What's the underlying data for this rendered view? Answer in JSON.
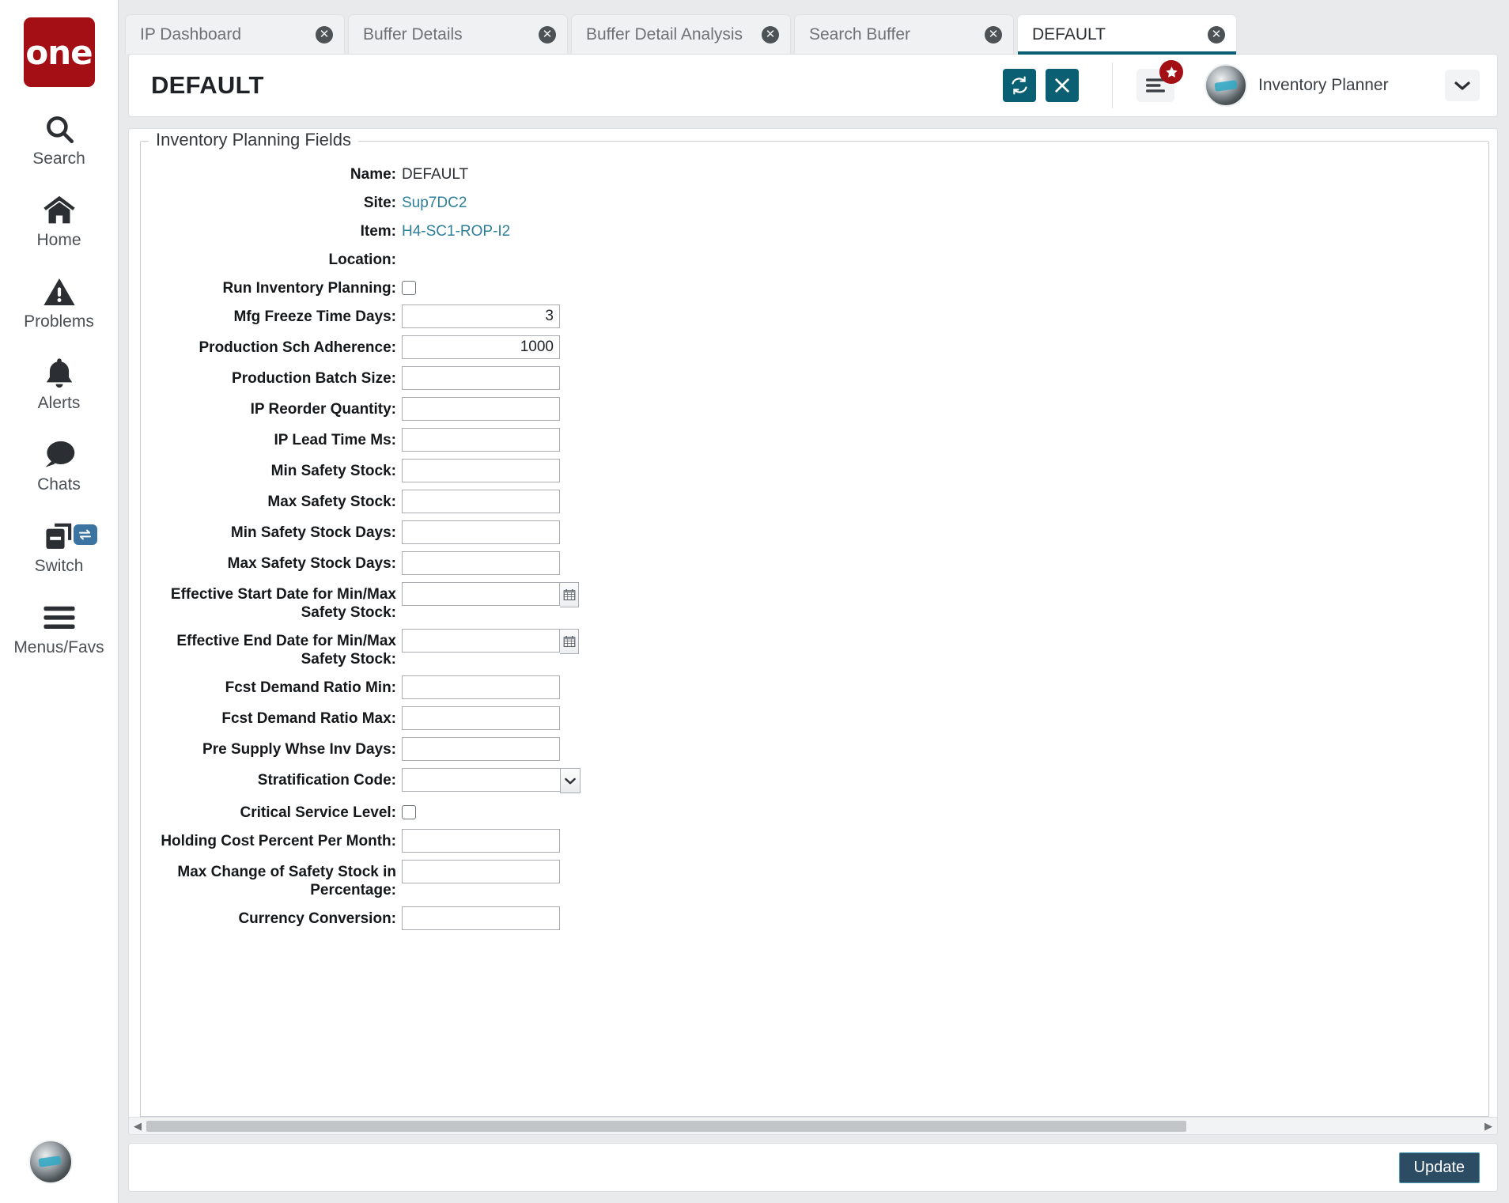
{
  "sidebar": {
    "logo_text": "one",
    "items": [
      {
        "label": "Search",
        "icon": "search-icon"
      },
      {
        "label": "Home",
        "icon": "home-icon"
      },
      {
        "label": "Problems",
        "icon": "warning-triangle-icon"
      },
      {
        "label": "Alerts",
        "icon": "bell-icon"
      },
      {
        "label": "Chats",
        "icon": "chat-bubble-icon"
      },
      {
        "label": "Switch",
        "icon": "switch-windows-icon"
      },
      {
        "label": "Menus/Favs",
        "icon": "hamburger-icon"
      }
    ]
  },
  "tabs": [
    {
      "label": "IP Dashboard",
      "active": false
    },
    {
      "label": "Buffer Details",
      "active": false
    },
    {
      "label": "Buffer Detail Analysis",
      "active": false
    },
    {
      "label": "Search Buffer",
      "active": false
    },
    {
      "label": "DEFAULT",
      "active": true
    }
  ],
  "header": {
    "title": "DEFAULT",
    "refresh_icon": "refresh-icon",
    "close_icon": "close-x-icon",
    "menu_icon": "hamburger-menu-icon",
    "menu_badge_icon": "star-badge-icon",
    "user_role": "Inventory Planner",
    "user_name_redacted": true,
    "user_email_redacted": true,
    "chevron_icon": "chevron-down-icon"
  },
  "form": {
    "legend": "Inventory Planning Fields",
    "rows": [
      {
        "label": "Name:",
        "type": "text",
        "value": "DEFAULT"
      },
      {
        "label": "Site:",
        "type": "link",
        "value": "Sup7DC2"
      },
      {
        "label": "Item:",
        "type": "link",
        "value": "H4-SC1-ROP-I2"
      },
      {
        "label": "Location:",
        "type": "text",
        "value": ""
      },
      {
        "label": "Run Inventory Planning:",
        "type": "checkbox",
        "checked": false
      },
      {
        "label": "Mfg Freeze Time Days:",
        "type": "input",
        "value": "3"
      },
      {
        "label": "Production Sch Adherence:",
        "type": "input",
        "value": "1000"
      },
      {
        "label": "Production Batch Size:",
        "type": "input",
        "value": ""
      },
      {
        "label": "IP Reorder Quantity:",
        "type": "input",
        "value": ""
      },
      {
        "label": "IP Lead Time Ms:",
        "type": "input",
        "value": ""
      },
      {
        "label": "Min Safety Stock:",
        "type": "input",
        "value": ""
      },
      {
        "label": "Max Safety Stock:",
        "type": "input",
        "value": ""
      },
      {
        "label": "Min Safety Stock Days:",
        "type": "input",
        "value": ""
      },
      {
        "label": "Max Safety Stock Days:",
        "type": "input",
        "value": ""
      },
      {
        "label": "Effective Start Date for Min/Max Safety Stock:",
        "type": "date",
        "value": ""
      },
      {
        "label": "Effective End Date for Min/Max Safety Stock:",
        "type": "date",
        "value": ""
      },
      {
        "label": "Fcst Demand Ratio Min:",
        "type": "input",
        "value": ""
      },
      {
        "label": "Fcst Demand Ratio Max:",
        "type": "input",
        "value": ""
      },
      {
        "label": "Pre Supply Whse Inv Days:",
        "type": "input",
        "value": ""
      },
      {
        "label": "Stratification Code:",
        "type": "select",
        "value": ""
      },
      {
        "label": "Critical Service Level:",
        "type": "checkbox",
        "checked": false
      },
      {
        "label": "Holding Cost Percent Per Month:",
        "type": "input",
        "value": ""
      },
      {
        "label": "Max Change of Safety Stock in Percentage:",
        "type": "input",
        "value": ""
      },
      {
        "label": "Currency Conversion:",
        "type": "input",
        "value": ""
      }
    ]
  },
  "footer": {
    "update_label": "Update"
  },
  "colors": {
    "brand_red": "#a30f14",
    "teal_action": "#0b5f73",
    "link": "#2d7f99",
    "update_button": "#2c4c63",
    "switch_badge": "#3b74a0"
  }
}
